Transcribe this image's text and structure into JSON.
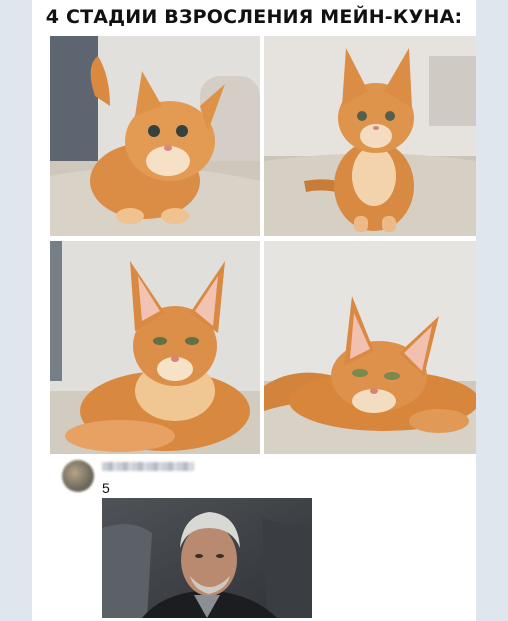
{
  "meme": {
    "title": "4 СТАДИИ ВЗРОСЛЕНИЯ МЕЙН-КУНА:"
  },
  "photos": [
    {
      "label": "kitten-stage-1"
    },
    {
      "label": "kitten-stage-2"
    },
    {
      "label": "young-cat-stage-3"
    },
    {
      "label": "adult-cat-stage-4"
    }
  ],
  "comment": {
    "text": "5"
  },
  "colors": {
    "cat_orange": "#d8893e",
    "cat_light": "#f3c98d",
    "blanket": "#cfc8bc",
    "wall": "#e9e7e4"
  }
}
